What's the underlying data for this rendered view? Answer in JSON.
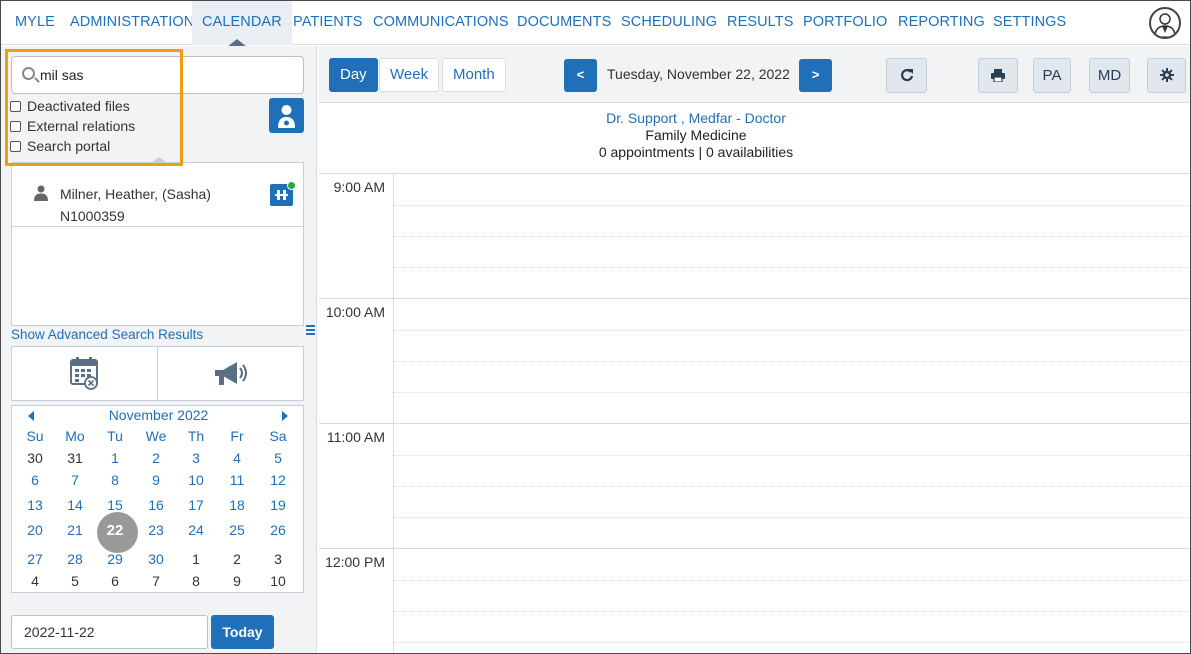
{
  "nav": {
    "items": [
      "MYLE",
      "ADMINISTRATION",
      "CALENDAR",
      "PATIENTS",
      "COMMUNICATIONS",
      "DOCUMENTS",
      "SCHEDULING",
      "RESULTS",
      "PORTFOLIO",
      "REPORTING",
      "SETTINGS"
    ],
    "active": "CALENDAR"
  },
  "search": {
    "value": "mil sas",
    "options": [
      "Deactivated files",
      "External relations",
      "Search portal"
    ]
  },
  "results": [
    {
      "name": "Milner, Heather, (Sasha)",
      "id": "N1000359"
    }
  ],
  "advanced_link": "Show Advanced Search Results",
  "mini_calendar": {
    "month_label": "November 2022",
    "weekdays": [
      "Su",
      "Mo",
      "Tu",
      "We",
      "Th",
      "Fr",
      "Sa"
    ],
    "weeks": [
      [
        "30",
        "31",
        "1",
        "2",
        "3",
        "4",
        "5"
      ],
      [
        "6",
        "7",
        "8",
        "9",
        "10",
        "11",
        "12"
      ],
      [
        "13",
        "14",
        "15",
        "16",
        "17",
        "18",
        "19"
      ],
      [
        "20",
        "21",
        "22",
        "23",
        "24",
        "25",
        "26"
      ],
      [
        "27",
        "28",
        "29",
        "30",
        "1",
        "2",
        "3"
      ],
      [
        "4",
        "5",
        "6",
        "7",
        "8",
        "9",
        "10"
      ]
    ],
    "selected": "22"
  },
  "date_field": {
    "value": "2022-11-22",
    "today_label": "Today"
  },
  "toolbar": {
    "views": [
      "Day",
      "Week",
      "Month"
    ],
    "active_view": "Day",
    "prev_label": "<",
    "next_label": ">",
    "date_label": "Tuesday, November 22, 2022",
    "buttons": {
      "pa": "PA",
      "md": "MD"
    }
  },
  "provider": {
    "name": "Dr. Support , Medfar - Doctor",
    "specialty": "Family Medicine",
    "counts": "0 appointments | 0 availabilities"
  },
  "hours": [
    "9:00 AM",
    "10:00 AM",
    "11:00 AM",
    "12:00 PM"
  ],
  "colors": {
    "accent": "#1f6fb9",
    "highlight": "#f39c12",
    "selected_day": "#999999"
  }
}
